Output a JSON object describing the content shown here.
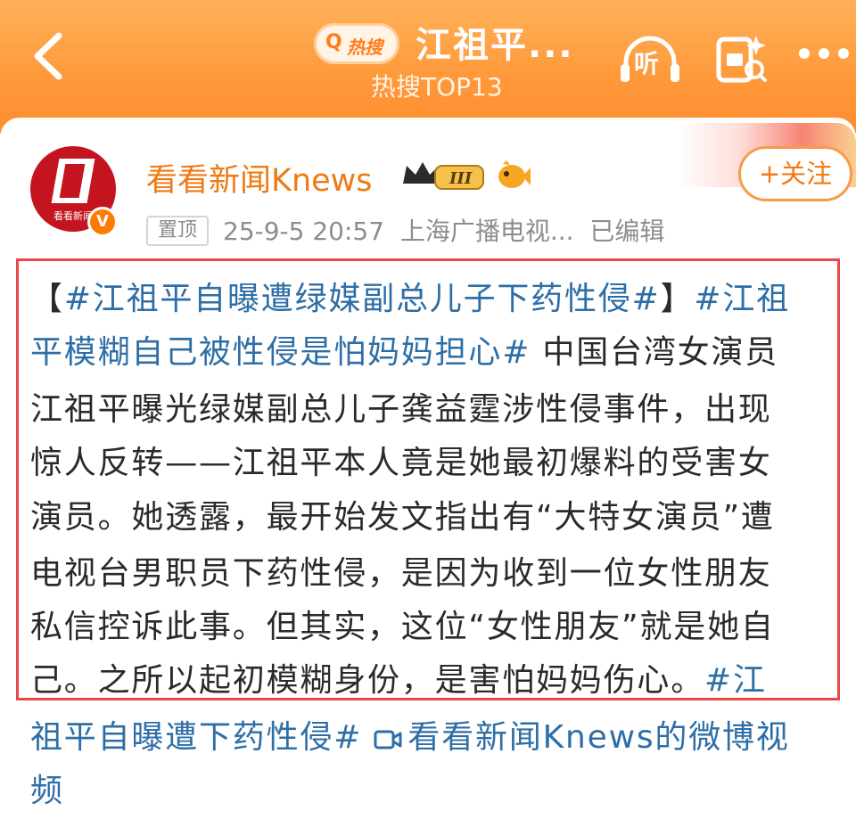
{
  "header": {
    "hot_badge_label": "热搜",
    "title": "江祖平...",
    "subtitle": "热搜TOP13",
    "listen_label": "听"
  },
  "author": {
    "name": "看看新闻Knews",
    "avatar_text": "看看新闻",
    "verified_mark": "V",
    "level_badge": "III",
    "follow_label": "+关注"
  },
  "post_meta": {
    "pin_label": "置顶",
    "timestamp": "25-9-5 20:57",
    "source": "上海广播电视...",
    "edited": "已编辑"
  },
  "post": {
    "line1_bracket_open": "【",
    "line1_tag1": "#江祖平自曝遭绿媒副总儿子下药性侵#",
    "line1_bracket_close": "】",
    "line1_tag2_start": "#江祖",
    "line2_tag2_end": "平模糊自己被性侵是怕妈妈担心#",
    "line2_text": " 中国台湾女演员",
    "line3": "江祖平曝光绿媒副总儿子龚益霆涉性侵事件，出现",
    "line4": "惊人反转——江祖平本人竟是她最初爆料的受害女",
    "line5": "演员。她透露，最开始发文指出有“大特女演员”遭",
    "line6": "电视台男职员下药性侵，是因为收到一位女性朋友",
    "line7": "私信控诉此事。但其实，这位“女性朋友”就是她自",
    "line8_text": "己。之所以起初模糊身份，是害怕妈妈伤心。",
    "line8_tag": "#江",
    "line9_tag": "祖平自曝遭下药性侵#",
    "line9_link": "看看新闻Knews的微博视",
    "line10_link": "频"
  },
  "colors": {
    "header_orange": "#ff9a3c",
    "accent_orange": "#ee7a14",
    "topic_blue": "#2e6ea6",
    "highlight_red": "#e8484a"
  }
}
